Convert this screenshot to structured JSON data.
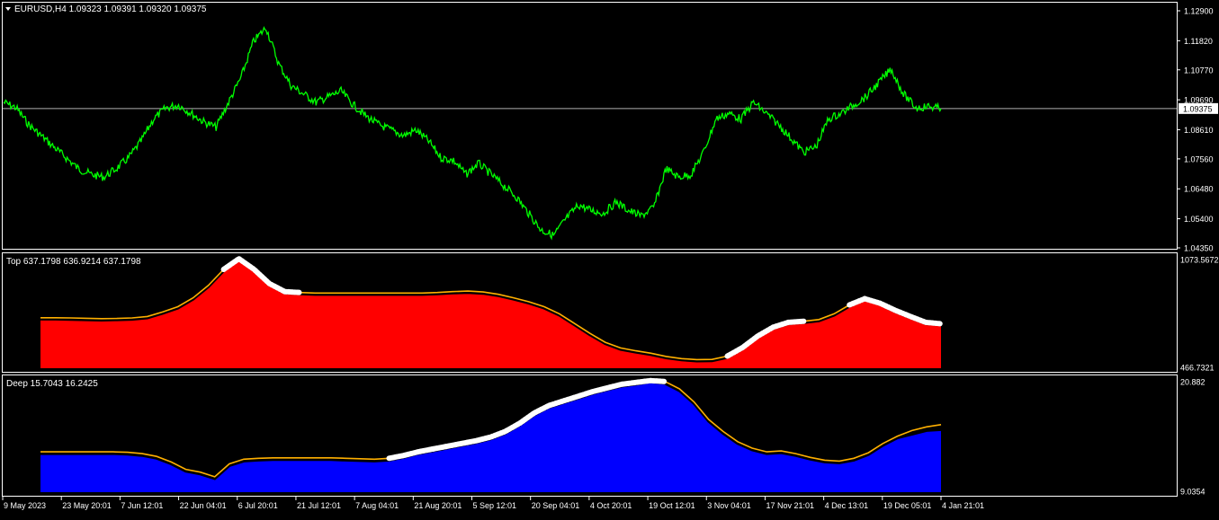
{
  "window": {
    "symbol_label": "EURUSD,H4  1.09323 1.09391 1.09320 1.09375",
    "menu_icon": "triangle-down-icon"
  },
  "colors": {
    "background": "#000000",
    "frame": "#ffffff",
    "price_line": "#00ff00",
    "top_fill": "#ff0000",
    "deep_fill": "#0000ff",
    "signal_line": "#ffb000",
    "marker": "#ffffff",
    "text": "#ffffff",
    "current_price_line": "#b0b0b0"
  },
  "chart_data": [
    {
      "type": "line",
      "pane": "price",
      "title": "EURUSD,H4  1.09323 1.09391 1.09320 1.09375",
      "ylim": [
        1.0435,
        1.129
      ],
      "y_ticks": [
        "1.12900",
        "1.11820",
        "1.10770",
        "1.09690",
        "1.08610",
        "1.07560",
        "1.06480",
        "1.05400",
        "1.04350"
      ],
      "y_tick_values": [
        1.129,
        1.1182,
        1.1077,
        1.0969,
        1.0861,
        1.0756,
        1.0648,
        1.054,
        1.0435
      ],
      "current_value": 1.09375,
      "current_label": "1.09375",
      "x_ticks": [
        "9 May 2023",
        "23 May 20:01",
        "7 Jun 12:01",
        "22 Jun 04:01",
        "6 Jul 20:01",
        "21 Jul 12:01",
        "7 Aug 04:01",
        "21 Aug 20:01",
        "5 Sep 12:01",
        "20 Sep 04:01",
        "4 Oct 20:01",
        "19 Oct 12:01",
        "3 Nov 04:01",
        "17 Nov 21:01",
        "4 Dec 13:01",
        "19 Dec 05:01",
        "4 Jan 21:01"
      ],
      "series": [
        {
          "values": [
            1.096,
            1.094,
            1.088,
            1.084,
            1.08,
            1.076,
            1.072,
            1.07,
            1.069,
            1.072,
            1.076,
            1.082,
            1.09,
            1.094,
            1.095,
            1.092,
            1.089,
            1.087,
            1.096,
            1.105,
            1.118,
            1.123,
            1.11,
            1.102,
            1.099,
            1.096,
            1.098,
            1.1,
            1.095,
            1.091,
            1.088,
            1.086,
            1.084,
            1.086,
            1.082,
            1.076,
            1.075,
            1.07,
            1.074,
            1.07,
            1.066,
            1.062,
            1.056,
            1.05,
            1.048,
            1.054,
            1.059,
            1.057,
            1.056,
            1.06,
            1.057,
            1.055,
            1.058,
            1.072,
            1.069,
            1.07,
            1.078,
            1.09,
            1.092,
            1.09,
            1.096,
            1.092,
            1.088,
            1.083,
            1.078,
            1.08,
            1.09,
            1.092,
            1.095,
            1.098,
            1.103,
            1.108,
            1.099,
            1.094,
            1.0945,
            1.09375
          ]
        }
      ]
    },
    {
      "type": "area",
      "pane": "top",
      "title": "Top 637.1798 636.9214 637.1798",
      "ylim": [
        466.7321,
        1073.5672
      ],
      "y_ticks": [
        "1073.5672",
        "466.7321"
      ],
      "y_tick_values": [
        1073.5672,
        466.7321
      ],
      "series": [
        {
          "name": "Top",
          "values": [
            738,
            738,
            736,
            734,
            732,
            734,
            737,
            745,
            770,
            800,
            850,
            920,
            1010,
            1073,
            1010,
            930,
            885,
            880,
            877,
            877,
            877,
            877,
            877,
            877,
            877,
            877,
            880,
            885,
            888,
            883,
            870,
            850,
            828,
            800,
            760,
            705,
            650,
            600,
            568,
            552,
            538,
            520,
            508,
            502,
            503,
            522,
            570,
            635,
            685,
            712,
            718,
            728,
            760,
            810,
            846,
            820,
            780,
            745,
            712,
            706
          ]
        },
        {
          "name": "Signal",
          "values": [
            746,
            746,
            745,
            743,
            741,
            742,
            745,
            753,
            778,
            808,
            858,
            928,
            1018,
            1078,
            1018,
            938,
            893,
            888,
            885,
            885,
            885,
            885,
            885,
            885,
            885,
            885,
            888,
            893,
            896,
            891,
            878,
            858,
            836,
            808,
            768,
            713,
            658,
            608,
            576,
            560,
            546,
            528,
            516,
            510,
            511,
            530,
            578,
            643,
            693,
            720,
            726,
            736,
            768,
            818,
            853,
            828,
            788,
            753,
            720,
            712
          ]
        }
      ],
      "markers": [
        {
          "from": 12,
          "to": 16
        },
        {
          "from": 16,
          "to": 17
        },
        {
          "from": 45,
          "to": 50
        },
        {
          "from": 53,
          "to": 59
        }
      ]
    },
    {
      "type": "area",
      "pane": "deep",
      "title": "Deep 15.7043 16.2425",
      "ylim": [
        9.0354,
        20.882
      ],
      "y_ticks": [
        "20.882",
        "9.0354"
      ],
      "y_tick_values": [
        20.882,
        9.0354
      ],
      "series": [
        {
          "name": "Deep",
          "values": [
            13.1,
            13.1,
            13.1,
            13.1,
            13.1,
            13.1,
            13.05,
            12.9,
            12.6,
            12.0,
            11.2,
            10.9,
            10.4,
            11.8,
            12.3,
            12.4,
            12.45,
            12.45,
            12.45,
            12.45,
            12.45,
            12.4,
            12.35,
            12.3,
            12.4,
            12.7,
            13.1,
            13.4,
            13.7,
            14.0,
            14.3,
            14.7,
            15.3,
            16.2,
            17.3,
            18.1,
            18.6,
            19.1,
            19.6,
            20.0,
            20.4,
            20.6,
            20.85,
            20.7,
            19.9,
            18.5,
            16.6,
            15.3,
            14.2,
            13.5,
            13.1,
            13.2,
            12.9,
            12.5,
            12.2,
            12.1,
            12.4,
            13.0,
            14.0,
            14.8,
            15.2,
            15.6,
            15.7
          ]
        },
        {
          "name": "Signal",
          "values": [
            13.3,
            13.3,
            13.3,
            13.3,
            13.3,
            13.3,
            13.25,
            13.1,
            12.8,
            12.2,
            11.4,
            11.1,
            10.6,
            12.0,
            12.5,
            12.6,
            12.65,
            12.65,
            12.65,
            12.65,
            12.65,
            12.6,
            12.55,
            12.5,
            12.6,
            12.9,
            13.3,
            13.6,
            13.9,
            14.2,
            14.5,
            14.9,
            15.5,
            16.4,
            17.5,
            18.3,
            18.8,
            19.3,
            19.8,
            20.2,
            20.6,
            20.8,
            21.0,
            20.9,
            20.1,
            18.7,
            16.8,
            15.5,
            14.4,
            13.7,
            13.3,
            13.4,
            13.1,
            12.7,
            12.4,
            12.3,
            12.6,
            13.2,
            14.2,
            15.0,
            15.6,
            16.0,
            16.24
          ]
        }
      ],
      "markers": [
        {
          "from": 24,
          "to": 27
        },
        {
          "from": 27,
          "to": 43
        }
      ]
    }
  ]
}
